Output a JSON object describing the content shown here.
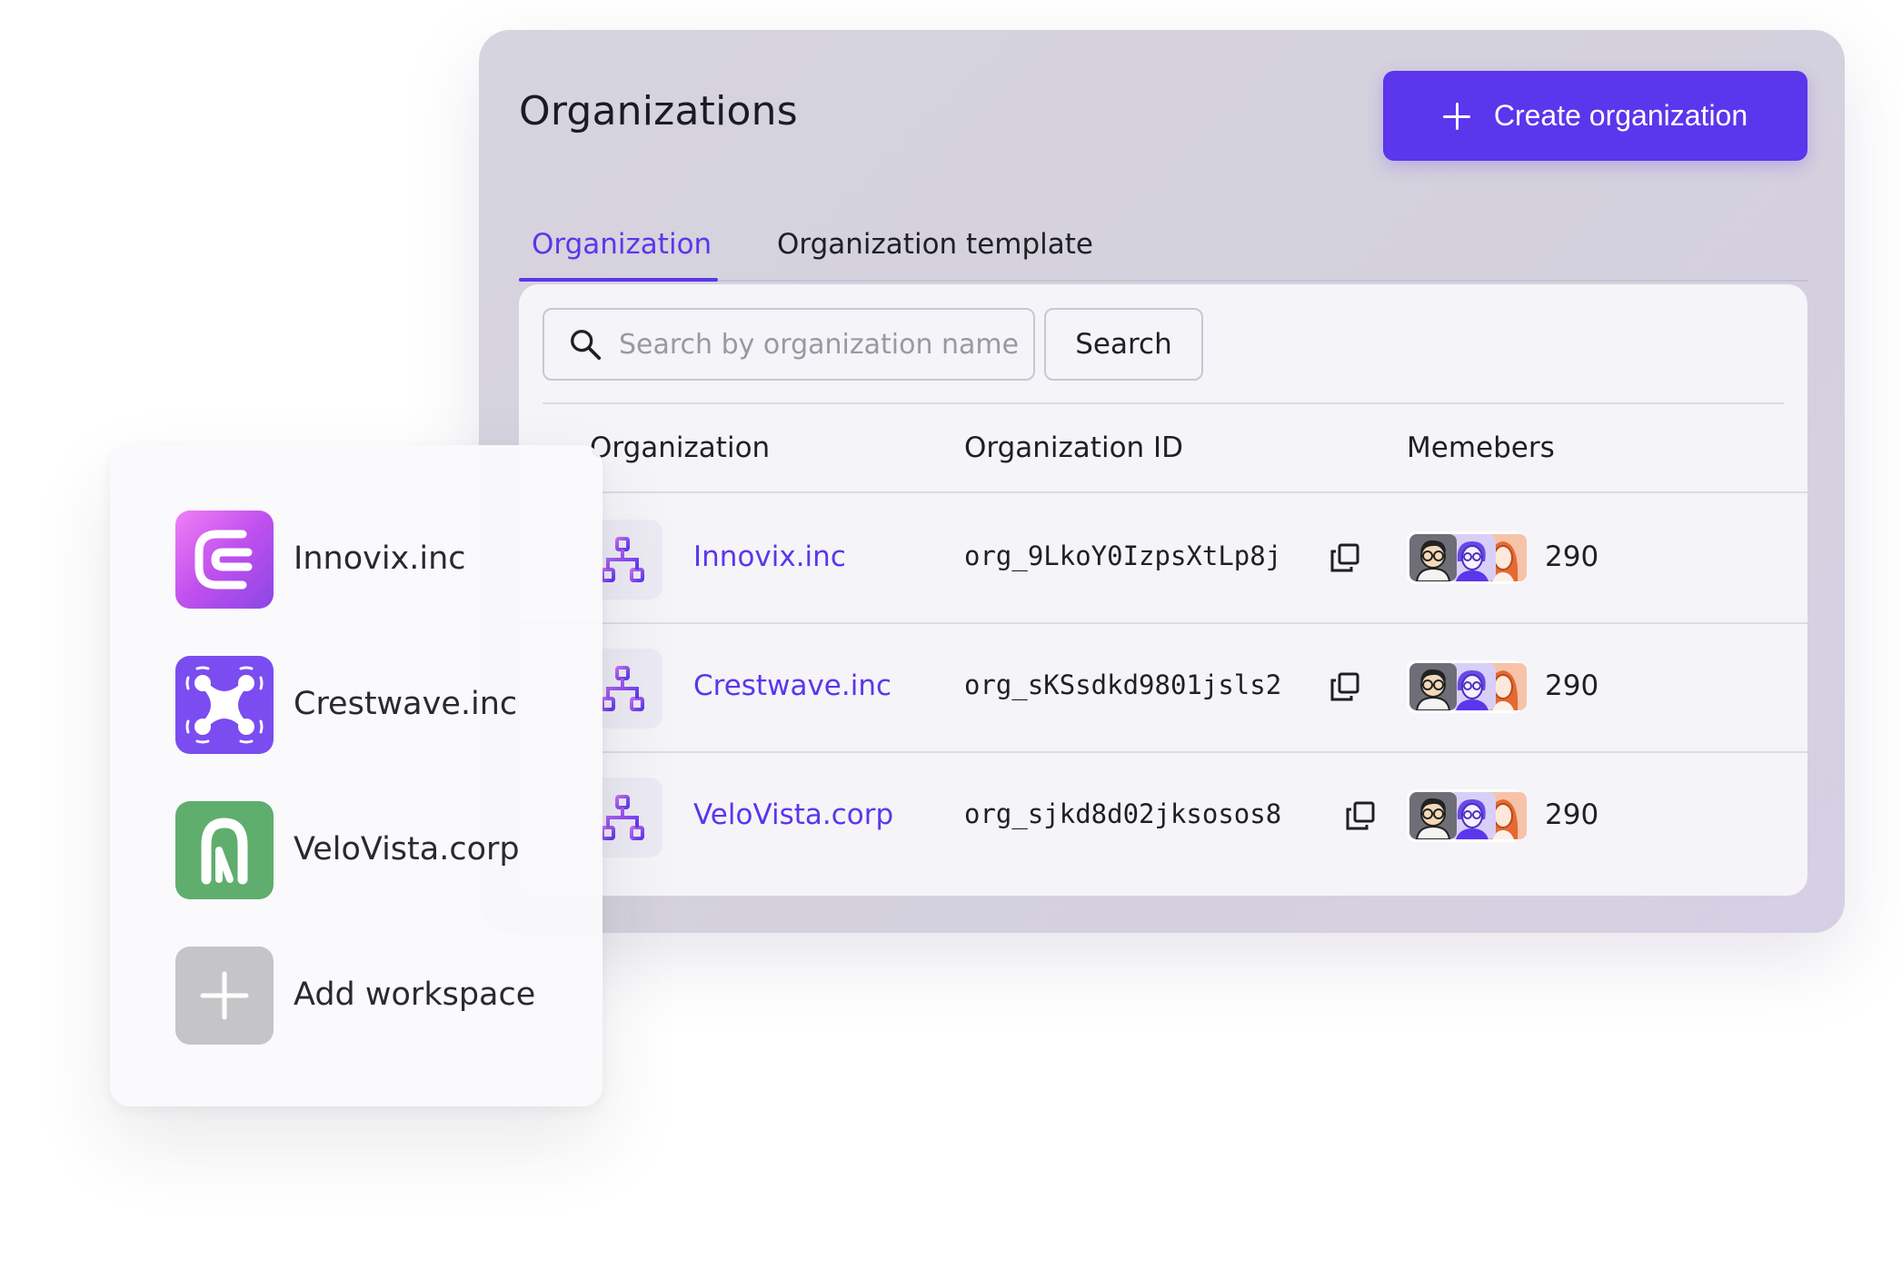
{
  "header": {
    "title": "Organizations",
    "create_button_label": "Create organization"
  },
  "tabs": [
    {
      "label": "Organization",
      "active": true
    },
    {
      "label": "Organization template",
      "active": false
    }
  ],
  "search": {
    "placeholder": "Search by organization name",
    "value": "",
    "button_label": "Search"
  },
  "table": {
    "columns": [
      "Organization",
      "Organization ID",
      "Memebers"
    ],
    "rows": [
      {
        "name": "Innovix.inc",
        "id": "org_9LkoY0IzpsXtLp8j",
        "members": "290"
      },
      {
        "name": "Crestwave.inc",
        "id": "org_sKSsdkd9801jsls2",
        "members": "290"
      },
      {
        "name": "VeloVista.corp",
        "id": "org_sjkd8d02jksosos8",
        "members": "290"
      }
    ]
  },
  "workspaces": {
    "items": [
      {
        "label": "Innovix.inc",
        "icon": "innovix-logo"
      },
      {
        "label": "Crestwave.inc",
        "icon": "crestwave-logo"
      },
      {
        "label": "VeloVista.corp",
        "icon": "velovista-logo"
      },
      {
        "label": "Add workspace",
        "icon": "plus-icon"
      }
    ]
  },
  "colors": {
    "accent": "#5b36ec",
    "panel_bg": "#d6d4de",
    "card_bg": "#f5f4f9",
    "innovix": "#c050ee",
    "crestwave": "#7b4cf0",
    "velovista": "#5fae6d",
    "add": "#c5c5c8"
  }
}
